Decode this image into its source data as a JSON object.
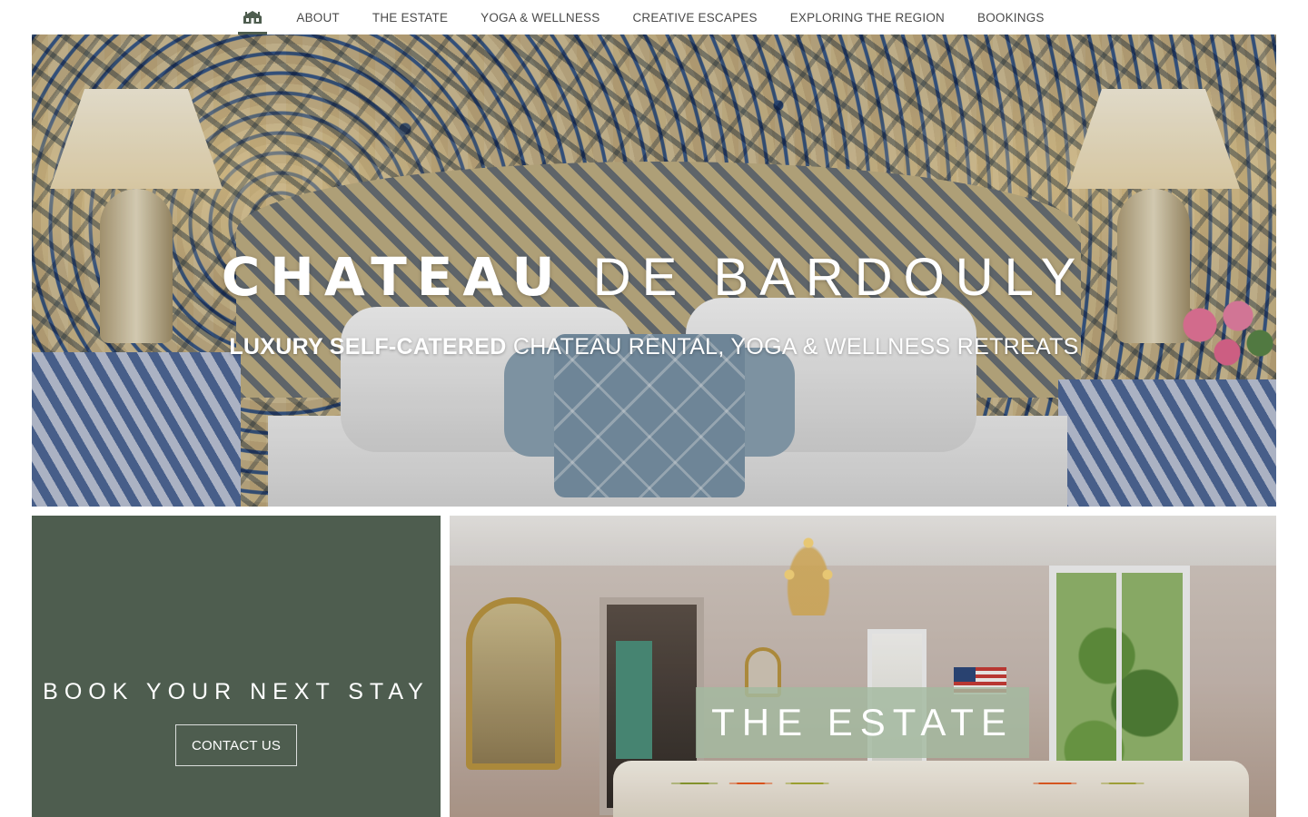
{
  "nav": {
    "home_icon": "chateau-home-icon",
    "items": [
      {
        "label": "ABOUT"
      },
      {
        "label": "THE ESTATE"
      },
      {
        "label": "YOGA & WELLNESS"
      },
      {
        "label": "CREATIVE ESCAPES"
      },
      {
        "label": "EXPLORING THE REGION"
      },
      {
        "label": "BOOKINGS"
      }
    ]
  },
  "hero": {
    "title_bold": "CHATEAU",
    "title_light": "DE BARDOULY",
    "subtitle_bold": "LUXURY SELF-CATERED",
    "subtitle_rest": "CHATEAU RENTAL, YOGA & WELLNESS RETREATS"
  },
  "book_panel": {
    "title": "BOOK YOUR NEXT STAY",
    "button_label": "CONTACT US"
  },
  "estate_panel": {
    "label": "THE ESTATE"
  },
  "colors": {
    "accent_green": "#4e5d4f",
    "label_sage": "#a4baa0",
    "nav_text": "#4a4a4a"
  }
}
